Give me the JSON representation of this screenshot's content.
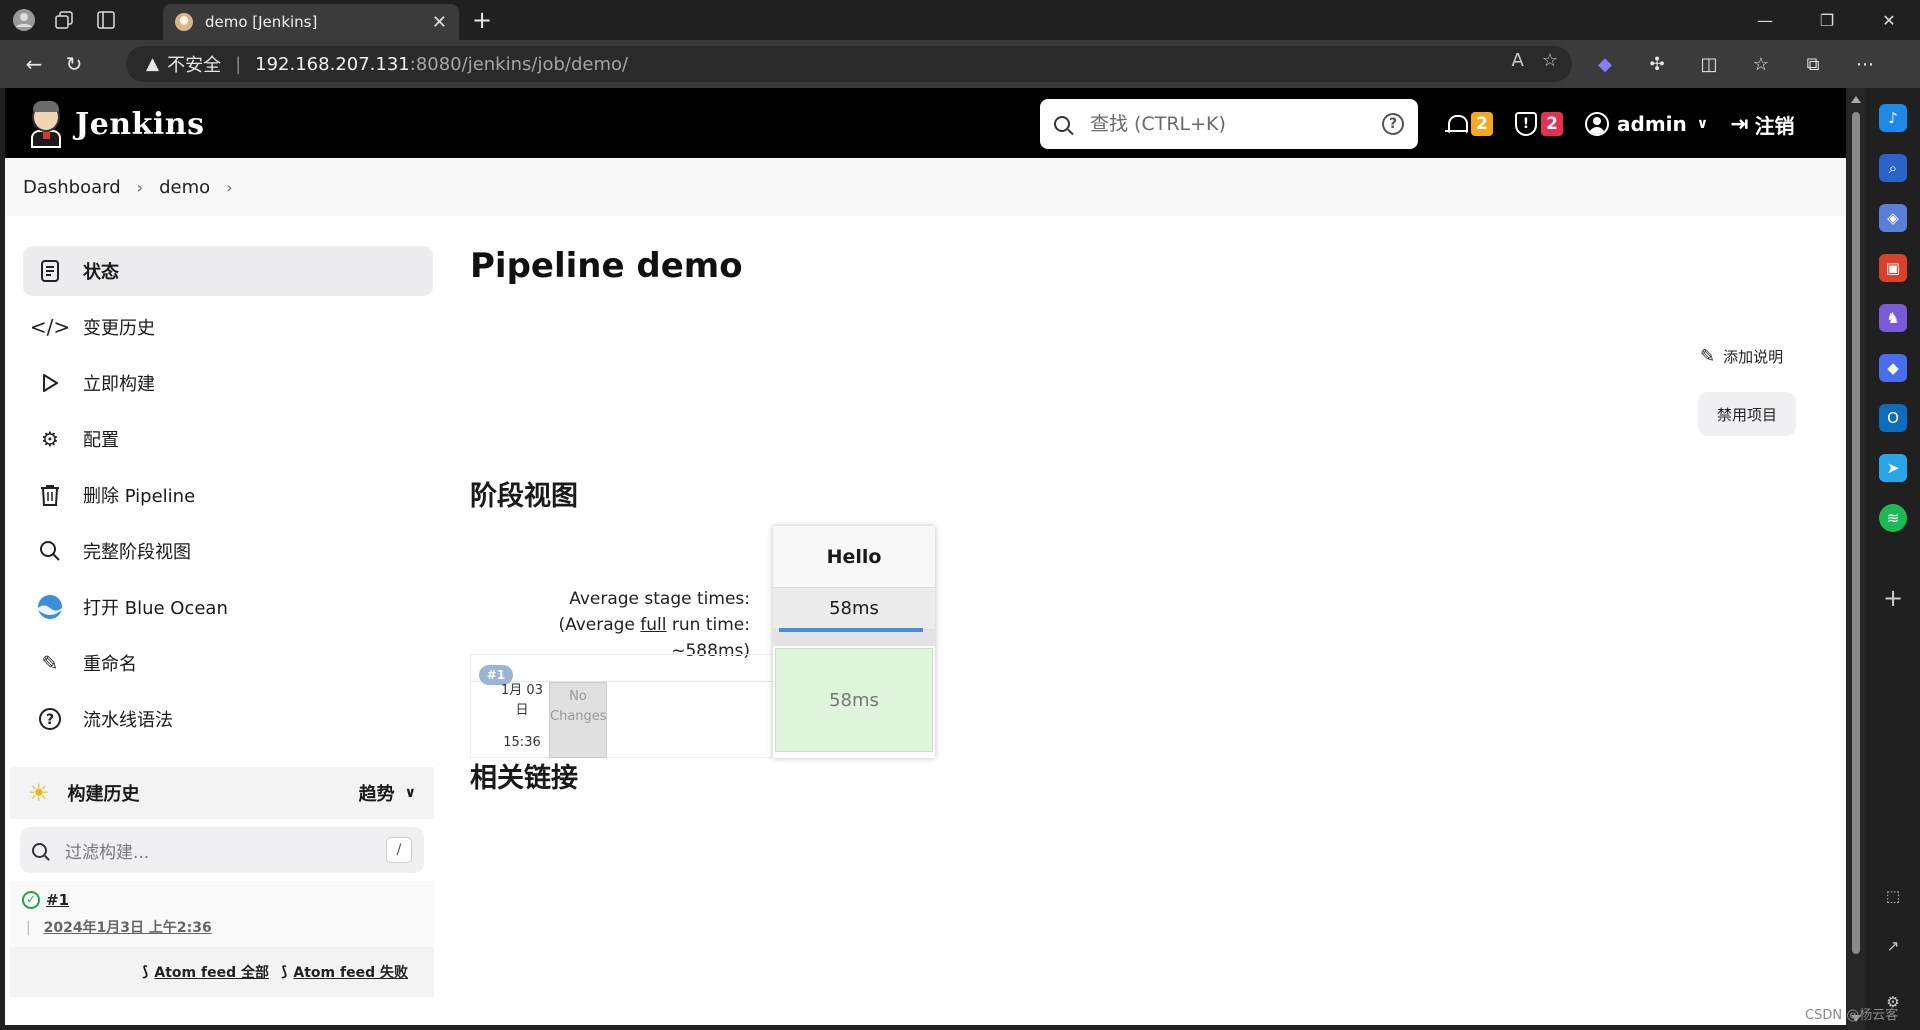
{
  "browser": {
    "tab_title": "demo [Jenkins]",
    "security_label": "不安全",
    "url_host": "192.168.207.131",
    "url_path": ":8080/jenkins/job/demo/"
  },
  "header": {
    "brand": "Jenkins",
    "search_placeholder": "查找 (CTRL+K)",
    "notifications_count": "2",
    "security_count": "2",
    "user": "admin",
    "logout": "注销"
  },
  "breadcrumb": [
    "Dashboard",
    "demo"
  ],
  "side_tasks": [
    {
      "label": "状态",
      "icon": "document-icon"
    },
    {
      "label": "变更历史",
      "icon": "code-icon"
    },
    {
      "label": "立即构建",
      "icon": "play-icon"
    },
    {
      "label": "配置",
      "icon": "gear-icon"
    },
    {
      "label": "删除 Pipeline",
      "icon": "trash-icon"
    },
    {
      "label": "完整阶段视图",
      "icon": "search-icon"
    },
    {
      "label": "打开 Blue Ocean",
      "icon": "blue-ocean-icon"
    },
    {
      "label": "重命名",
      "icon": "pencil-icon"
    },
    {
      "label": "流水线语法",
      "icon": "question-icon"
    }
  ],
  "build_history": {
    "title": "构建历史",
    "trend": "趋势",
    "filter_placeholder": "过滤构建...",
    "filter_shortcut": "/",
    "builds": [
      {
        "number": "#1",
        "date": "2024年1月3日 上午2:36"
      }
    ],
    "feed_all": "Atom feed 全部",
    "feed_fail": "Atom feed 失败"
  },
  "main": {
    "title": "Pipeline demo",
    "add_description": "添加说明",
    "disable_button": "禁用项目",
    "stage_view_title": "阶段视图",
    "related_links_title": "相关链接"
  },
  "stage_view": {
    "avg_stage_label": "Average stage times:",
    "avg_full_prefix": "(Average ",
    "avg_full_link": "full",
    "avg_full_suffix": " run time:",
    "avg_full_value": "~588ms)",
    "stage_name": "Hello",
    "stage_avg": "58ms",
    "run": {
      "badge": "#1",
      "date_line1": "1月 03",
      "date_line2": "日",
      "time": "15:36",
      "changes_line1": "No",
      "changes_line2": "Changes",
      "stage_duration": "58ms"
    }
  },
  "watermark": "CSDN @杨云客"
}
